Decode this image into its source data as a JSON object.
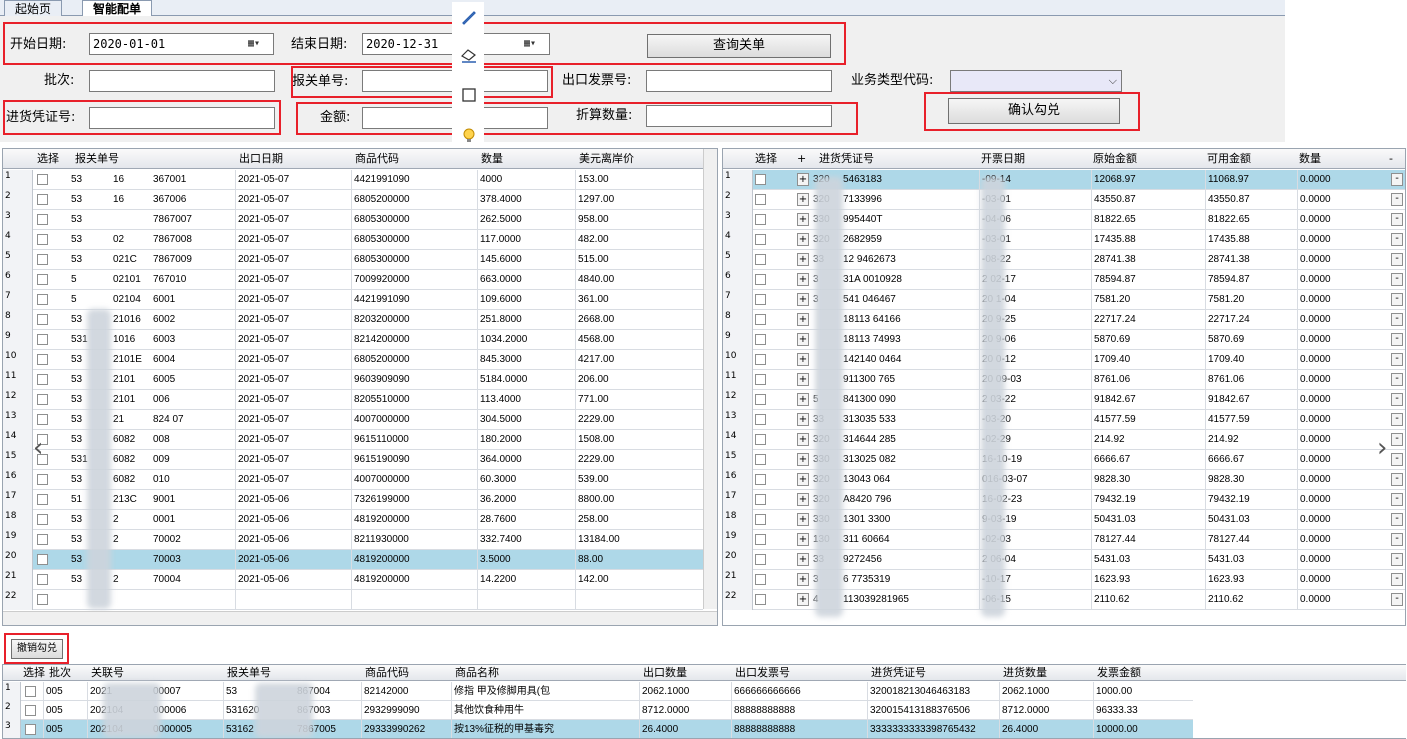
{
  "tabs": [
    {
      "label": "起始页"
    },
    {
      "label": "智能配单"
    }
  ],
  "form": {
    "start_date_label": "开始日期:",
    "start_date": "2020-01-01",
    "end_date_label": "结束日期:",
    "end_date": "2020-12-31",
    "query_button": "查询关单",
    "batch_label": "批次:",
    "batch_value": "",
    "customs_no_label": "报关单号:",
    "customs_no_value": "",
    "export_invoice_label": "出口发票号:",
    "export_invoice_value": "",
    "biz_type_label": "业务类型代码:",
    "purchase_voucher_label": "进货凭证号:",
    "purchase_voucher_value": "",
    "amount_label": "金额:",
    "amount_value": "",
    "converted_qty_label": "折算数量:",
    "converted_qty_value": "",
    "confirm_button": "确认勾兑"
  },
  "toolbar_icons": [
    "brush-icon",
    "eraser-icon",
    "rectangle-icon",
    "bulb-icon",
    "text-format-icon"
  ],
  "left_grid": {
    "headers": [
      "选择",
      "报关单号",
      "出口日期",
      "商品代码",
      "数量",
      "美元离岸价"
    ],
    "rows": [
      {
        "num": "1",
        "decl": "53",
        "decl2": "16",
        "decl3": "367001",
        "date": "2021-05-07",
        "code": "4421991090",
        "qty": "4000",
        "usd": "153.00"
      },
      {
        "num": "2",
        "decl": "53",
        "decl2": "16",
        "decl3": "367006",
        "date": "2021-05-07",
        "code": "6805200000",
        "qty": "378.4000",
        "usd": "1297.00"
      },
      {
        "num": "3",
        "decl": "53",
        "decl2": "",
        "decl3": "7867007",
        "date": "2021-05-07",
        "code": "6805300000",
        "qty": "262.5000",
        "usd": "958.00"
      },
      {
        "num": "4",
        "decl": "53",
        "decl2": "02",
        "decl3": "7867008",
        "date": "2021-05-07",
        "code": "6805300000",
        "qty": "117.0000",
        "usd": "482.00"
      },
      {
        "num": "5",
        "decl": "53",
        "decl2": "021C",
        "decl3": "7867009",
        "date": "2021-05-07",
        "code": "6805300000",
        "qty": "145.6000",
        "usd": "515.00"
      },
      {
        "num": "6",
        "decl": "5",
        "decl2": "02101",
        "decl3": "767010",
        "date": "2021-05-07",
        "code": "7009920000",
        "qty": "663.0000",
        "usd": "4840.00"
      },
      {
        "num": "7",
        "decl": "5",
        "decl2": "02104",
        "decl3": "6001",
        "date": "2021-05-07",
        "code": "4421991090",
        "qty": "109.6000",
        "usd": "361.00"
      },
      {
        "num": "8",
        "decl": "53",
        "decl2": "21016",
        "decl3": "6002",
        "date": "2021-05-07",
        "code": "8203200000",
        "qty": "251.8000",
        "usd": "2668.00"
      },
      {
        "num": "9",
        "decl": "531",
        "decl2": "1016",
        "decl3": "6003",
        "date": "2021-05-07",
        "code": "8214200000",
        "qty": "1034.2000",
        "usd": "4568.00"
      },
      {
        "num": "10",
        "decl": "53",
        "decl2": "2101E",
        "decl3": "6004",
        "date": "2021-05-07",
        "code": "6805200000",
        "qty": "845.3000",
        "usd": "4217.00"
      },
      {
        "num": "11",
        "decl": "53",
        "decl2": "2101",
        "decl3": "6005",
        "date": "2021-05-07",
        "code": "9603909090",
        "qty": "5184.0000",
        "usd": "206.00"
      },
      {
        "num": "12",
        "decl": "53",
        "decl2": "2101",
        "decl3": "006",
        "date": "2021-05-07",
        "code": "8205510000",
        "qty": "113.4000",
        "usd": "771.00"
      },
      {
        "num": "13",
        "decl": "53",
        "decl2": "21",
        "decl3": "824 07",
        "date": "2021-05-07",
        "code": "4007000000",
        "qty": "304.5000",
        "usd": "2229.00"
      },
      {
        "num": "14",
        "decl": "53",
        "decl2": "6082",
        "decl3": "008",
        "date": "2021-05-07",
        "code": "9615110000",
        "qty": "180.2000",
        "usd": "1508.00"
      },
      {
        "num": "15",
        "decl": "531",
        "decl2": "6082",
        "decl3": "009",
        "date": "2021-05-07",
        "code": "9615190090",
        "qty": "364.0000",
        "usd": "2229.00"
      },
      {
        "num": "16",
        "decl": "53",
        "decl2": "6082",
        "decl3": "010",
        "date": "2021-05-07",
        "code": "4007000000",
        "qty": "60.3000",
        "usd": "539.00"
      },
      {
        "num": "17",
        "decl": "51",
        "decl2": "213C",
        "decl3": "9001",
        "date": "2021-05-06",
        "code": "7326199000",
        "qty": "36.2000",
        "usd": "8800.00"
      },
      {
        "num": "18",
        "decl": "53",
        "decl2": "2",
        "decl3": "0001",
        "date": "2021-05-06",
        "code": "4819200000",
        "qty": "28.7600",
        "usd": "258.00"
      },
      {
        "num": "19",
        "decl": "53",
        "decl2": "2",
        "decl3": "70002",
        "date": "2021-05-06",
        "code": "8211930000",
        "qty": "332.7400",
        "usd": "13184.00"
      },
      {
        "num": "20",
        "decl": "53",
        "decl2": "",
        "decl3": "70003",
        "date": "2021-05-06",
        "code": "4819200000",
        "qty": "3.5000",
        "usd": "88.00"
      },
      {
        "num": "21",
        "decl": "53",
        "decl2": "2",
        "decl3": "70004",
        "date": "2021-05-06",
        "code": "4819200000",
        "qty": "14.2200",
        "usd": "142.00"
      },
      {
        "num": "22",
        "decl": "",
        "decl2": "",
        "decl3": "",
        "date": "",
        "code": "",
        "qty": "",
        "usd": ""
      }
    ]
  },
  "right_grid": {
    "headers": [
      "选择",
      "+",
      "进货凭证号",
      "开票日期",
      "原始金额",
      "可用金额",
      "数量",
      "-"
    ],
    "rows": [
      {
        "num": "1",
        "voucher": "320",
        "voucher2": "5463183",
        "date": "-09-14",
        "orig": "12068.97",
        "avail": "11068.97",
        "qty": "0.0000"
      },
      {
        "num": "2",
        "voucher": "320",
        "voucher2": "7133996",
        "date": "-03-01",
        "orig": "43550.87",
        "avail": "43550.87",
        "qty": "0.0000"
      },
      {
        "num": "3",
        "voucher": "330",
        "voucher2": "995440T",
        "date": "-04-06",
        "orig": "81822.65",
        "avail": "81822.65",
        "qty": "0.0000"
      },
      {
        "num": "4",
        "voucher": "320",
        "voucher2": "2682959",
        "date": "-03-01",
        "orig": "17435.88",
        "avail": "17435.88",
        "qty": "0.0000"
      },
      {
        "num": "5",
        "voucher": "33",
        "voucher2": "12 9462673",
        "date": "-08-22",
        "orig": "28741.38",
        "avail": "28741.38",
        "qty": "0.0000"
      },
      {
        "num": "6",
        "voucher": "3",
        "voucher2": "31A 0010928",
        "date": "2 02-17",
        "orig": "78594.87",
        "avail": "78594.87",
        "qty": "0.0000"
      },
      {
        "num": "7",
        "voucher": "3",
        "voucher2": "541 046467",
        "date": "20 1-04",
        "orig": "7581.20",
        "avail": "7581.20",
        "qty": "0.0000"
      },
      {
        "num": "8",
        "voucher": "",
        "voucher2": "18113 64166",
        "date": "20 9-25",
        "orig": "22717.24",
        "avail": "22717.24",
        "qty": "0.0000"
      },
      {
        "num": "9",
        "voucher": "",
        "voucher2": "18113 74993",
        "date": "20 9-06",
        "orig": "5870.69",
        "avail": "5870.69",
        "qty": "0.0000"
      },
      {
        "num": "10",
        "voucher": "",
        "voucher2": "142140 0464",
        "date": "20 0-12",
        "orig": "1709.40",
        "avail": "1709.40",
        "qty": "0.0000"
      },
      {
        "num": "11",
        "voucher": "",
        "voucher2": "911300 765",
        "date": "20 09-03",
        "orig": "8761.06",
        "avail": "8761.06",
        "qty": "0.0000"
      },
      {
        "num": "12",
        "voucher": "5",
        "voucher2": "841300 090",
        "date": "2 03-22",
        "orig": "91842.67",
        "avail": "91842.67",
        "qty": "0.0000"
      },
      {
        "num": "13",
        "voucher": "33",
        "voucher2": "313035 533",
        "date": "-03-20",
        "orig": "41577.59",
        "avail": "41577.59",
        "qty": "0.0000"
      },
      {
        "num": "14",
        "voucher": "320",
        "voucher2": "314644 285",
        "date": "-02-29",
        "orig": "214.92",
        "avail": "214.92",
        "qty": "0.0000"
      },
      {
        "num": "15",
        "voucher": "330",
        "voucher2": "313025 082",
        "date": "16-10-19",
        "orig": "6666.67",
        "avail": "6666.67",
        "qty": "0.0000"
      },
      {
        "num": "16",
        "voucher": "320",
        "voucher2": "13043 064",
        "date": "016-03-07",
        "orig": "9828.30",
        "avail": "9828.30",
        "qty": "0.0000"
      },
      {
        "num": "17",
        "voucher": "320",
        "voucher2": "A8420 796",
        "date": "16-02-23",
        "orig": "79432.19",
        "avail": "79432.19",
        "qty": "0.0000"
      },
      {
        "num": "18",
        "voucher": "330",
        "voucher2": "1301 3300",
        "date": "9-03-19",
        "orig": "50431.03",
        "avail": "50431.03",
        "qty": "0.0000"
      },
      {
        "num": "19",
        "voucher": "130",
        "voucher2": "311 60664",
        "date": "-02-03",
        "orig": "78127.44",
        "avail": "78127.44",
        "qty": "0.0000"
      },
      {
        "num": "20",
        "voucher": "33",
        "voucher2": "9272456",
        "date": "2 06-04",
        "orig": "5431.03",
        "avail": "5431.03",
        "qty": "0.0000"
      },
      {
        "num": "21",
        "voucher": "3",
        "voucher2": "6 7735319",
        "date": "-10-17",
        "orig": "1623.93",
        "avail": "1623.93",
        "qty": "0.0000"
      },
      {
        "num": "22",
        "voucher": "4",
        "voucher2": "113039281965",
        "date": "-06-15",
        "orig": "2110.62",
        "avail": "2110.62",
        "qty": "0.0000"
      }
    ]
  },
  "undo_button": "撤销勾兑",
  "bottom_grid": {
    "headers": [
      "选择",
      "批次",
      "关联号",
      "报关单号",
      "商品代码",
      "商品名称",
      "出口数量",
      "出口发票号",
      "进货凭证号",
      "进货数量",
      "发票金额"
    ],
    "rows": [
      {
        "num": "1",
        "batch": "005",
        "rel": "2021",
        "rel2": "00007",
        "decl": "53",
        "decl2": "867004",
        "code": "82142000",
        "name": "修指 甲及修脚用具(包",
        "qty": "2062.1000",
        "inv": "666666666666",
        "voucher": "320018213046463183",
        "pqty": "2062.1000",
        "amt": "1000.00"
      },
      {
        "num": "2",
        "batch": "005",
        "rel": "202104",
        "rel2": "000006",
        "decl": "531620",
        "decl2": "867003",
        "code": "2932999090",
        "name": "其他饮食种用牛",
        "qty": "8712.0000",
        "inv": "88888888888",
        "voucher": "320015413188376506",
        "pqty": "8712.0000",
        "amt": "96333.33"
      },
      {
        "num": "3",
        "batch": "005",
        "rel": "202104",
        "rel2": "0000005",
        "decl": "53162",
        "decl2": "7867005",
        "code": "29333990262",
        "name": "按13%征税的甲基毒究",
        "qty": "26.4000",
        "inv": "88888888888",
        "voucher": "3333333333398765432",
        "pqty": "26.4000",
        "amt": "10000.00"
      }
    ]
  },
  "colors": {
    "selected_row": "#aed8e8",
    "highlight_border": "#e8202a",
    "form_bg": "#f0f0f0"
  }
}
